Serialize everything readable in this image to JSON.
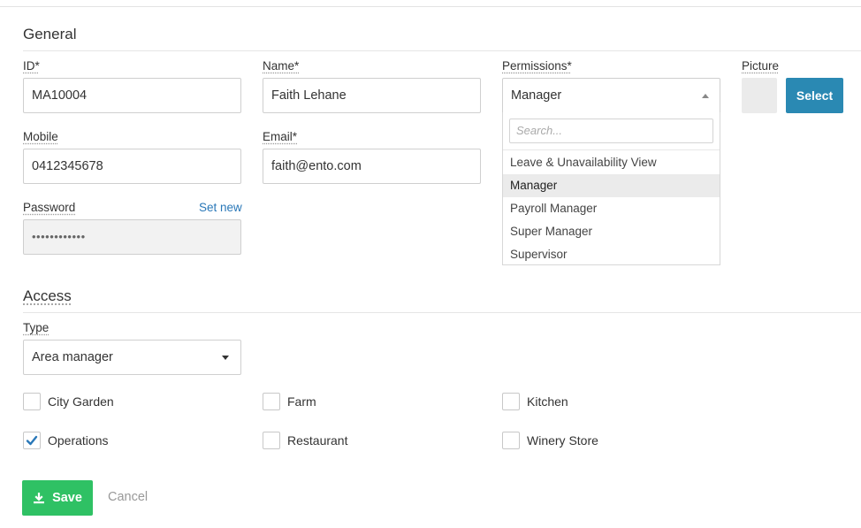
{
  "general": {
    "title": "General",
    "id": {
      "label": "ID*",
      "value": "MA10004"
    },
    "name": {
      "label": "Name*",
      "value": "Faith Lehane"
    },
    "permissions": {
      "label": "Permissions*",
      "value": "Manager",
      "search_placeholder": "Search...",
      "options": [
        "Leave & Unavailability View",
        "Manager",
        "Payroll Manager",
        "Super Manager",
        "Supervisor"
      ],
      "selected_index": 1
    },
    "picture": {
      "label": "Picture",
      "select_label": "Select"
    },
    "mobile": {
      "label": "Mobile",
      "value": "0412345678"
    },
    "email": {
      "label": "Email*",
      "value": "faith@ento.com"
    },
    "password": {
      "label": "Password",
      "set_new_label": "Set new",
      "value": "••••••••••••"
    }
  },
  "access": {
    "title": "Access",
    "type": {
      "label": "Type",
      "value": "Area manager"
    },
    "locations": [
      {
        "label": "City Garden",
        "checked": false
      },
      {
        "label": "Farm",
        "checked": false
      },
      {
        "label": "Kitchen",
        "checked": false
      },
      {
        "label": "Operations",
        "checked": true
      },
      {
        "label": "Restaurant",
        "checked": false
      },
      {
        "label": "Winery Store",
        "checked": false
      }
    ]
  },
  "actions": {
    "save_label": "Save",
    "cancel_label": "Cancel"
  },
  "colors": {
    "primary": "#2a89b3",
    "save": "#2fc164",
    "link": "#2a78b8",
    "check": "#2a78b8"
  },
  "icons": {
    "save": "download-icon",
    "check": "checkmark-icon",
    "caret_up": "caret-up-icon",
    "caret_down": "caret-down-icon"
  }
}
